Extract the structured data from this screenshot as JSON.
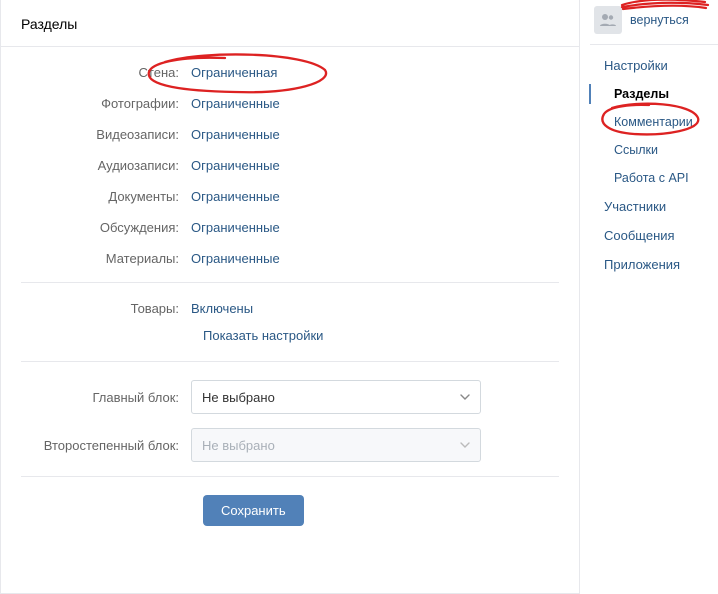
{
  "header": {
    "title": "Разделы"
  },
  "sections": [
    {
      "label": "Стена:",
      "value": "Ограниченная"
    },
    {
      "label": "Фотографии:",
      "value": "Ограниченные"
    },
    {
      "label": "Видеозаписи:",
      "value": "Ограниченные"
    },
    {
      "label": "Аудиозаписи:",
      "value": "Ограниченные"
    },
    {
      "label": "Документы:",
      "value": "Ограниченные"
    },
    {
      "label": "Обсуждения:",
      "value": "Ограниченные"
    },
    {
      "label": "Материалы:",
      "value": "Ограниченные"
    }
  ],
  "goods": {
    "label": "Товары:",
    "value": "Включены",
    "show_settings": "Показать настройки"
  },
  "blocks": {
    "main_label": "Главный блок:",
    "main_value": "Не выбрано",
    "secondary_label": "Второстепенный блок:",
    "secondary_value": "Не выбрано"
  },
  "save_label": "Сохранить",
  "sidebar": {
    "back_label": "вернуться",
    "nav": {
      "settings": "Настройки",
      "sections": "Разделы",
      "comments": "Комментарии",
      "links": "Ссылки",
      "api": "Работа с API",
      "members": "Участники",
      "messages": "Сообщения",
      "apps": "Приложения"
    }
  }
}
